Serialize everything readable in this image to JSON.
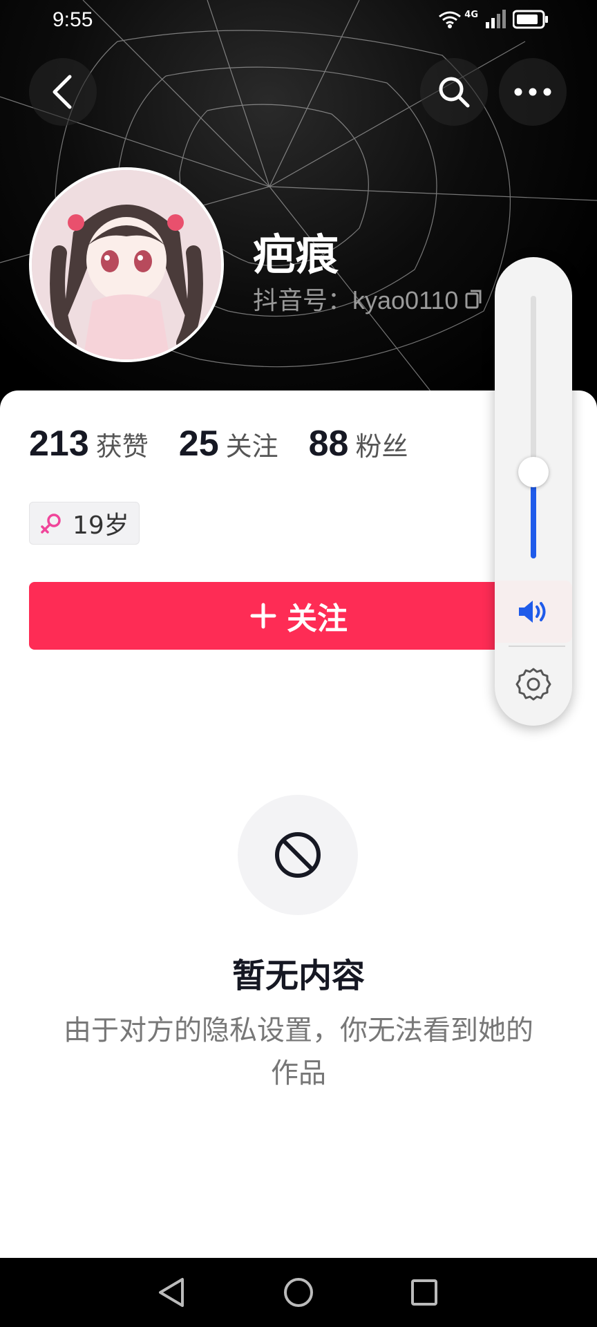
{
  "status_bar": {
    "time": "9:55",
    "network": "4G"
  },
  "header": {
    "back_icon": "chevron-left-icon",
    "search_icon": "search-icon",
    "more_icon": "more-dots-icon"
  },
  "profile": {
    "nickname": "疤痕",
    "douyin_id": "抖音号：kyao0110",
    "copy_icon": "copy-icon"
  },
  "stats": [
    {
      "value": "213",
      "label": "获赞"
    },
    {
      "value": "25",
      "label": "关注"
    },
    {
      "value": "88",
      "label": "粉丝"
    }
  ],
  "tags": {
    "gender_icon": "female-icon",
    "age": "19岁",
    "gender_color": "#f0459a"
  },
  "follow_button": {
    "label": "关注",
    "icon": "plus-icon",
    "color": "#fe2c55"
  },
  "empty_state": {
    "icon": "blocked-icon",
    "title": "暂无内容",
    "description": "由于对方的隐私设置，你无法看到她的作品"
  },
  "volume_panel": {
    "level": 0.33,
    "speaker_icon": "speaker-icon",
    "settings_icon": "gear-icon",
    "accent_color": "#1f5bea"
  },
  "nav_bar": {
    "back": "triangle-back-icon",
    "home": "circle-home-icon",
    "recents": "square-recents-icon"
  }
}
